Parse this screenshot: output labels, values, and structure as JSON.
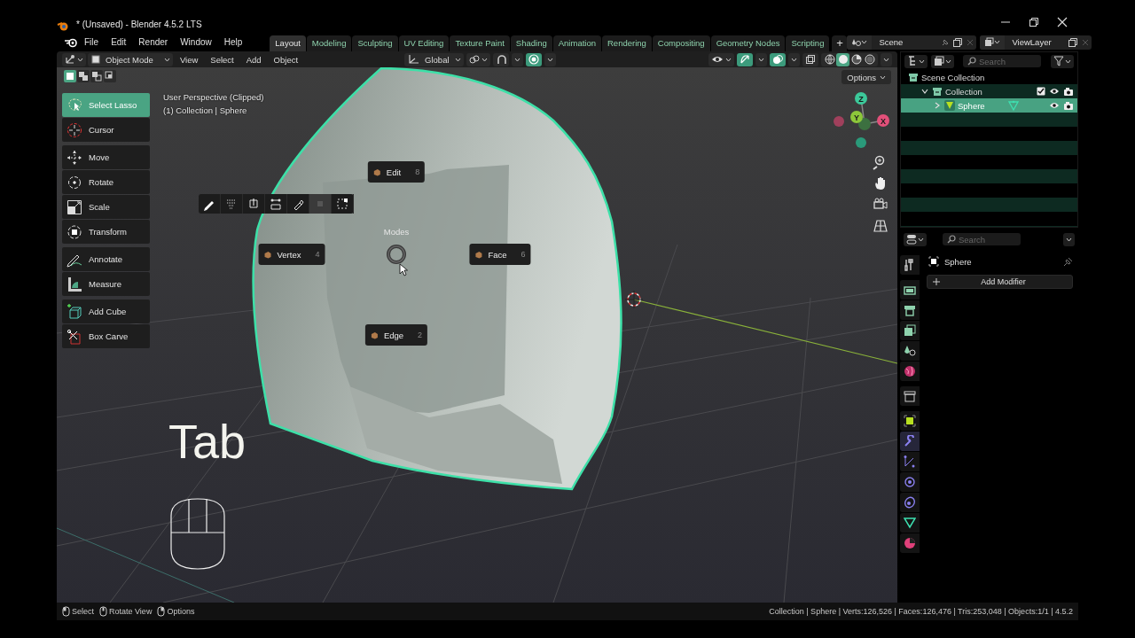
{
  "window": {
    "title": "* (Unsaved) - Blender 4.5.2 LTS"
  },
  "menu": [
    "File",
    "Edit",
    "Render",
    "Window",
    "Help"
  ],
  "workspaces": [
    {
      "label": "Layout",
      "selected": true
    },
    {
      "label": "Modeling",
      "selected": false
    },
    {
      "label": "Sculpting",
      "selected": false
    },
    {
      "label": "UV Editing",
      "selected": false
    },
    {
      "label": "Texture Paint",
      "selected": false
    },
    {
      "label": "Shading",
      "selected": false
    },
    {
      "label": "Animation",
      "selected": false
    },
    {
      "label": "Rendering",
      "selected": false
    },
    {
      "label": "Compositing",
      "selected": false
    },
    {
      "label": "Geometry Nodes",
      "selected": false
    },
    {
      "label": "Scripting",
      "selected": false
    }
  ],
  "add_workspace": "+",
  "scene": {
    "name": "Scene"
  },
  "view_layer": {
    "name": "ViewLayer"
  },
  "viewport": {
    "header": {
      "mode": "Object Mode",
      "menus": [
        "View",
        "Select",
        "Add",
        "Object"
      ],
      "orientation": "Global",
      "toggles": [
        {
          "kind": "snap",
          "on": false
        },
        {
          "kind": "proportional",
          "on": true
        },
        {
          "kind": "gizmo",
          "on": true
        },
        {
          "kind": "overlay",
          "on": true
        },
        {
          "kind": "xray",
          "on": false
        }
      ],
      "shading": [
        {
          "selected": false
        },
        {
          "selected": true
        },
        {
          "selected": false
        },
        {
          "selected": false
        }
      ]
    },
    "select_modes": [
      {
        "selected": true
      },
      {
        "selected": false
      },
      {
        "selected": false
      },
      {
        "selected": false
      }
    ],
    "options": "Options",
    "overlay_lines": [
      "User Perspective (Clipped)",
      "(1) Collection | Sphere"
    ],
    "tool_groups": [
      {
        "tools": [
          {
            "label": "Select Lasso",
            "selected": true
          },
          {
            "label": "Cursor",
            "selected": false
          }
        ]
      },
      {
        "tools": [
          {
            "label": "Move",
            "selected": false
          },
          {
            "label": "Rotate",
            "selected": false
          },
          {
            "label": "Scale",
            "selected": false
          },
          {
            "label": "Transform",
            "selected": false
          }
        ]
      },
      {
        "tools": [
          {
            "label": "Annotate",
            "selected": false
          },
          {
            "label": "Measure",
            "selected": false
          }
        ]
      },
      {
        "tools": [
          {
            "label": "Add Cube",
            "selected": false
          },
          {
            "label": "Box Carve",
            "selected": false
          }
        ]
      }
    ],
    "edit_tools": [
      {
        "disabled": false
      },
      {
        "disabled": false
      },
      {
        "disabled": false
      },
      {
        "disabled": false
      },
      {
        "disabled": false
      },
      {
        "disabled": true
      },
      {
        "disabled": false
      }
    ],
    "pie": {
      "title": "Modes",
      "items": [
        {
          "label": "Edit",
          "key": "8"
        },
        {
          "label": "Vertex",
          "key": "4"
        },
        {
          "label": "Face",
          "key": "6"
        },
        {
          "label": "Edge",
          "key": "2"
        }
      ]
    },
    "gizmo_axes": [
      {
        "label": "Z"
      },
      {
        "label": "Y"
      },
      {
        "label": "X"
      }
    ],
    "key_hint": "Tab"
  },
  "outliner": {
    "search": {
      "placeholder": "Search"
    },
    "tree": [
      {
        "label": "Scene Collection",
        "kind": "scene",
        "children": [
          {
            "label": "Collection",
            "kind": "collection",
            "expanded": true,
            "checked": true,
            "selected": false,
            "children": [
              {
                "label": "Sphere",
                "kind": "mesh",
                "expanded": false,
                "selected": true
              }
            ]
          }
        ]
      }
    ]
  },
  "properties": {
    "search": {
      "placeholder": "Search"
    },
    "object_name": "Sphere",
    "button": "Add Modifier",
    "tab_groups": [
      {
        "tabs": [
          {
            "selected": false
          }
        ]
      },
      {
        "tabs": [
          {
            "selected": false
          },
          {
            "selected": false
          },
          {
            "selected": false
          },
          {
            "selected": false
          },
          {
            "selected": false
          }
        ]
      },
      {
        "tabs": [
          {
            "selected": false
          }
        ]
      },
      {
        "tabs": [
          {
            "selected": false
          },
          {
            "selected": true
          },
          {
            "selected": false
          },
          {
            "selected": false
          },
          {
            "selected": false
          },
          {
            "selected": false
          },
          {
            "selected": false
          }
        ]
      }
    ]
  },
  "status_bar": {
    "hints": [
      "Select",
      "Rotate View",
      "Options"
    ],
    "stats": "Collection | Sphere | Verts:126,526 | Faces:126,476 | Tris:253,048 | Objects:1/1 | 4.5.2"
  }
}
